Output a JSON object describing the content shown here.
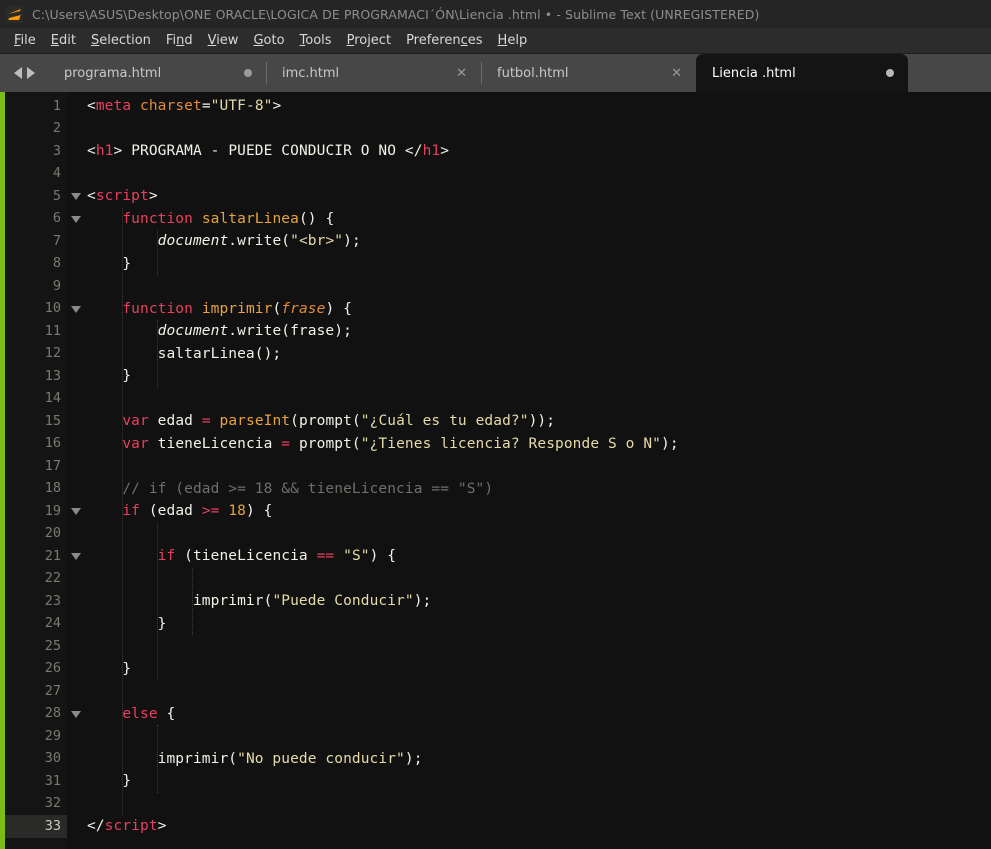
{
  "window": {
    "title": "C:\\Users\\ASUS\\Desktop\\ONE ORACLE\\LOGICA DE PROGRAMACI´ÓN\\Liencia .html • - Sublime Text (UNREGISTERED)",
    "logo_name": "sublime-text-logo"
  },
  "menubar": {
    "items": [
      {
        "label": "File",
        "accel_index": 0
      },
      {
        "label": "Edit",
        "accel_index": 0
      },
      {
        "label": "Selection",
        "accel_index": 0
      },
      {
        "label": "Find",
        "accel_index": 2
      },
      {
        "label": "View",
        "accel_index": 0
      },
      {
        "label": "Goto",
        "accel_index": 0
      },
      {
        "label": "Tools",
        "accel_index": 0
      },
      {
        "label": "Project",
        "accel_index": 0
      },
      {
        "label": "Preferences",
        "accel_index": 8
      },
      {
        "label": "Help",
        "accel_index": 0
      }
    ]
  },
  "tabs": {
    "nav_prev": "◀",
    "nav_next": "▶",
    "items": [
      {
        "label": "programa.html",
        "active": false,
        "dirty": true,
        "close_glyph": ""
      },
      {
        "label": "imc.html",
        "active": false,
        "dirty": false,
        "close_glyph": "✕"
      },
      {
        "label": "futbol.html",
        "active": false,
        "dirty": false,
        "close_glyph": "✕"
      },
      {
        "label": "Liencia .html",
        "active": true,
        "dirty": true,
        "close_glyph": ""
      }
    ]
  },
  "editor": {
    "current_line": 33,
    "colors": {
      "background": "#111111",
      "gutter": "#141414",
      "left_strip": "#7bbd16",
      "tag": "#e8405e",
      "attribute": "#e08c3a",
      "string": "#e6dba8",
      "keyword": "#e8405e",
      "function": "#e8a33d",
      "number": "#e8a33d",
      "comment": "#6f6f68",
      "text": "#f2f2e8"
    },
    "lines": [
      {
        "n": 1,
        "fold": false,
        "tokens": [
          {
            "t": "punct",
            "v": "<"
          },
          {
            "t": "tag",
            "v": "meta"
          },
          {
            "t": "plain",
            "v": " "
          },
          {
            "t": "attr",
            "v": "charset"
          },
          {
            "t": "punct",
            "v": "="
          },
          {
            "t": "str",
            "v": "\"UTF-8\""
          },
          {
            "t": "punct",
            "v": ">"
          }
        ]
      },
      {
        "n": 2,
        "fold": false,
        "tokens": []
      },
      {
        "n": 3,
        "fold": false,
        "tokens": [
          {
            "t": "punct",
            "v": "<"
          },
          {
            "t": "tag",
            "v": "h1"
          },
          {
            "t": "punct",
            "v": ">"
          },
          {
            "t": "plain",
            "v": " PROGRAMA - PUEDE CONDUCIR O NO "
          },
          {
            "t": "punct",
            "v": "</"
          },
          {
            "t": "tag",
            "v": "h1"
          },
          {
            "t": "punct",
            "v": ">"
          }
        ]
      },
      {
        "n": 4,
        "fold": false,
        "tokens": []
      },
      {
        "n": 5,
        "fold": true,
        "tokens": [
          {
            "t": "punct",
            "v": "<"
          },
          {
            "t": "tag",
            "v": "script"
          },
          {
            "t": "punct",
            "v": ">"
          }
        ]
      },
      {
        "n": 6,
        "fold": true,
        "tokens": [
          {
            "t": "plain",
            "v": "    "
          },
          {
            "t": "kw",
            "v": "function"
          },
          {
            "t": "plain",
            "v": " "
          },
          {
            "t": "fn",
            "v": "saltarLinea"
          },
          {
            "t": "punct",
            "v": "() {"
          }
        ]
      },
      {
        "n": 7,
        "fold": false,
        "tokens": [
          {
            "t": "plain",
            "v": "        "
          },
          {
            "t": "obj",
            "v": "document"
          },
          {
            "t": "punct",
            "v": "."
          },
          {
            "t": "plain",
            "v": "write"
          },
          {
            "t": "punct",
            "v": "("
          },
          {
            "t": "str",
            "v": "\"<br>\""
          },
          {
            "t": "punct",
            "v": ");"
          }
        ]
      },
      {
        "n": 8,
        "fold": false,
        "tokens": [
          {
            "t": "plain",
            "v": "    }"
          }
        ]
      },
      {
        "n": 9,
        "fold": false,
        "tokens": []
      },
      {
        "n": 10,
        "fold": true,
        "tokens": [
          {
            "t": "plain",
            "v": "    "
          },
          {
            "t": "kw",
            "v": "function"
          },
          {
            "t": "plain",
            "v": " "
          },
          {
            "t": "fn",
            "v": "imprimir"
          },
          {
            "t": "punct",
            "v": "("
          },
          {
            "t": "param",
            "v": "frase"
          },
          {
            "t": "punct",
            "v": ") {"
          }
        ]
      },
      {
        "n": 11,
        "fold": false,
        "tokens": [
          {
            "t": "plain",
            "v": "        "
          },
          {
            "t": "obj",
            "v": "document"
          },
          {
            "t": "punct",
            "v": "."
          },
          {
            "t": "plain",
            "v": "write(frase);"
          }
        ]
      },
      {
        "n": 12,
        "fold": false,
        "tokens": [
          {
            "t": "plain",
            "v": "        saltarLinea();"
          }
        ]
      },
      {
        "n": 13,
        "fold": false,
        "tokens": [
          {
            "t": "plain",
            "v": "    }"
          }
        ]
      },
      {
        "n": 14,
        "fold": false,
        "tokens": []
      },
      {
        "n": 15,
        "fold": false,
        "tokens": [
          {
            "t": "plain",
            "v": "    "
          },
          {
            "t": "kw",
            "v": "var"
          },
          {
            "t": "plain",
            "v": " edad "
          },
          {
            "t": "op",
            "v": "="
          },
          {
            "t": "plain",
            "v": " "
          },
          {
            "t": "fn",
            "v": "parseInt"
          },
          {
            "t": "punct",
            "v": "("
          },
          {
            "t": "plain",
            "v": "prompt("
          },
          {
            "t": "str",
            "v": "\"¿Cuál es tu edad?\""
          },
          {
            "t": "punct",
            "v": "));"
          }
        ]
      },
      {
        "n": 16,
        "fold": false,
        "tokens": [
          {
            "t": "plain",
            "v": "    "
          },
          {
            "t": "kw",
            "v": "var"
          },
          {
            "t": "plain",
            "v": " tieneLicencia "
          },
          {
            "t": "op",
            "v": "="
          },
          {
            "t": "plain",
            "v": " prompt("
          },
          {
            "t": "str",
            "v": "\"¿Tienes licencia? Responde S o N\""
          },
          {
            "t": "punct",
            "v": ");"
          }
        ]
      },
      {
        "n": 17,
        "fold": false,
        "tokens": []
      },
      {
        "n": 18,
        "fold": false,
        "tokens": [
          {
            "t": "plain",
            "v": "    "
          },
          {
            "t": "comment",
            "v": "// if (edad >= 18 && tieneLicencia == \"S\")"
          }
        ]
      },
      {
        "n": 19,
        "fold": true,
        "tokens": [
          {
            "t": "plain",
            "v": "    "
          },
          {
            "t": "kw",
            "v": "if"
          },
          {
            "t": "plain",
            "v": " (edad "
          },
          {
            "t": "op",
            "v": ">="
          },
          {
            "t": "plain",
            "v": " "
          },
          {
            "t": "num",
            "v": "18"
          },
          {
            "t": "punct",
            "v": ") {"
          }
        ]
      },
      {
        "n": 20,
        "fold": false,
        "tokens": []
      },
      {
        "n": 21,
        "fold": true,
        "tokens": [
          {
            "t": "plain",
            "v": "        "
          },
          {
            "t": "kw",
            "v": "if"
          },
          {
            "t": "plain",
            "v": " (tieneLicencia "
          },
          {
            "t": "op",
            "v": "=="
          },
          {
            "t": "plain",
            "v": " "
          },
          {
            "t": "str",
            "v": "\"S\""
          },
          {
            "t": "punct",
            "v": ") {"
          }
        ]
      },
      {
        "n": 22,
        "fold": false,
        "tokens": []
      },
      {
        "n": 23,
        "fold": false,
        "tokens": [
          {
            "t": "plain",
            "v": "            imprimir("
          },
          {
            "t": "str",
            "v": "\"Puede Conducir\""
          },
          {
            "t": "punct",
            "v": ");"
          }
        ]
      },
      {
        "n": 24,
        "fold": false,
        "tokens": [
          {
            "t": "plain",
            "v": "        }"
          }
        ]
      },
      {
        "n": 25,
        "fold": false,
        "tokens": []
      },
      {
        "n": 26,
        "fold": false,
        "tokens": [
          {
            "t": "plain",
            "v": "    }"
          }
        ]
      },
      {
        "n": 27,
        "fold": false,
        "tokens": []
      },
      {
        "n": 28,
        "fold": true,
        "tokens": [
          {
            "t": "plain",
            "v": "    "
          },
          {
            "t": "kw",
            "v": "else"
          },
          {
            "t": "punct",
            "v": " {"
          }
        ]
      },
      {
        "n": 29,
        "fold": false,
        "tokens": []
      },
      {
        "n": 30,
        "fold": false,
        "tokens": [
          {
            "t": "plain",
            "v": "        imprimir("
          },
          {
            "t": "str",
            "v": "\"No puede conducir\""
          },
          {
            "t": "punct",
            "v": ");"
          }
        ]
      },
      {
        "n": 31,
        "fold": false,
        "tokens": [
          {
            "t": "plain",
            "v": "    }"
          }
        ]
      },
      {
        "n": 32,
        "fold": false,
        "tokens": []
      },
      {
        "n": 33,
        "fold": false,
        "tokens": [
          {
            "t": "punct",
            "v": "</"
          },
          {
            "t": "tag",
            "v": "script"
          },
          {
            "t": "punct",
            "v": ">"
          }
        ]
      }
    ]
  }
}
